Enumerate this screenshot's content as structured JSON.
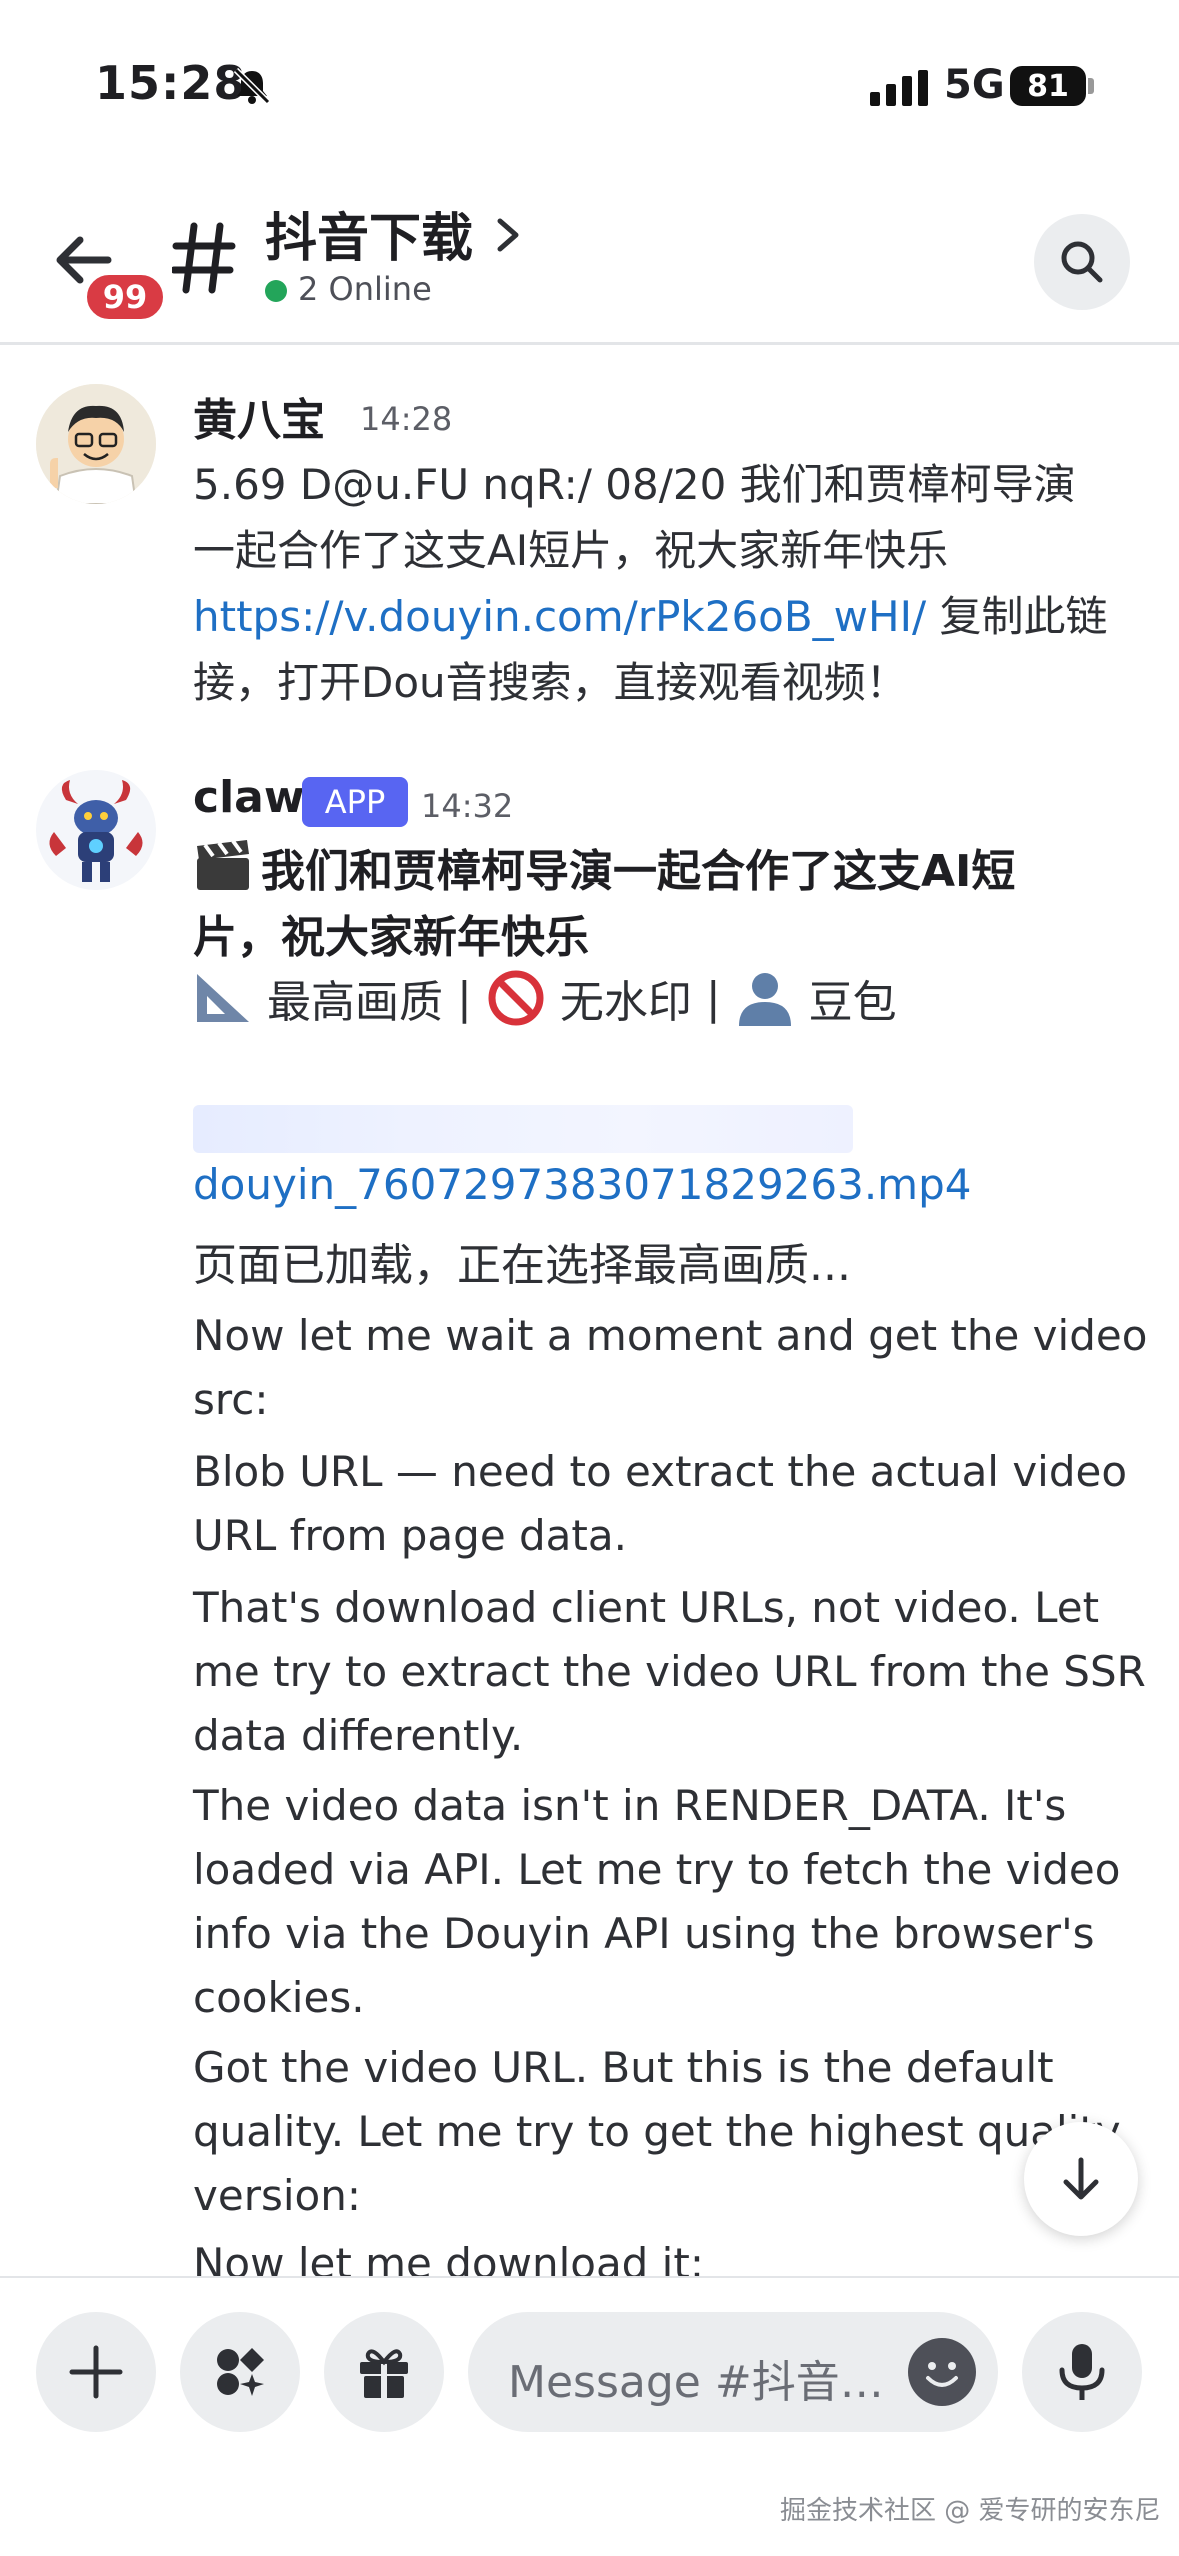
{
  "status_bar": {
    "time": "15:28",
    "network": "5G",
    "battery": "81"
  },
  "header": {
    "unread_count": "99",
    "channel_name": "抖音下载",
    "online_text": "2 Online"
  },
  "messages": [
    {
      "author": "黄八宝",
      "time": "14:28",
      "text_line1": "5.69 D@u.FU nqR:/ 08/20 我们和贾樟柯导演",
      "text_line2": "一起合作了这支AI短片，祝大家新年快乐",
      "link": "https://v.douyin.com/rPk26oB_wHI/",
      "link_suffix": " 复制此链",
      "text_line4": "接，打开Dou音搜索，直接观看视频！"
    },
    {
      "author": "claw",
      "badge": "APP",
      "time": "14:32",
      "title_line1": "我们和贾樟柯导演一起合作了这支AI短",
      "title_line2": "片，祝大家新年快乐",
      "meta": {
        "quality": "最高画质",
        "sep": "|",
        "watermark": "无水印",
        "author": "豆包"
      },
      "file_link": "douyin_7607297383071829263.mp4",
      "status": "页面已加载，正在选择最高画质...",
      "log": [
        "Now let me wait a moment and get the video src:",
        "Blob URL — need to extract the actual video URL from page data.",
        "That's download client URLs, not video. Let me try to extract the video URL from the SSR data differently.",
        "The video data isn't in RENDER_DATA. It's loaded via API. Let me try to fetch the video info via the Douyin API using the browser's cookies.",
        "Got the video URL. But this is the default quality. Let me try to get the highest quality version:",
        "Now let me download it:"
      ]
    }
  ],
  "composer": {
    "placeholder": "Message #抖音…"
  },
  "watermark": "掘金技术社区 @ 爱专研的安东尼"
}
